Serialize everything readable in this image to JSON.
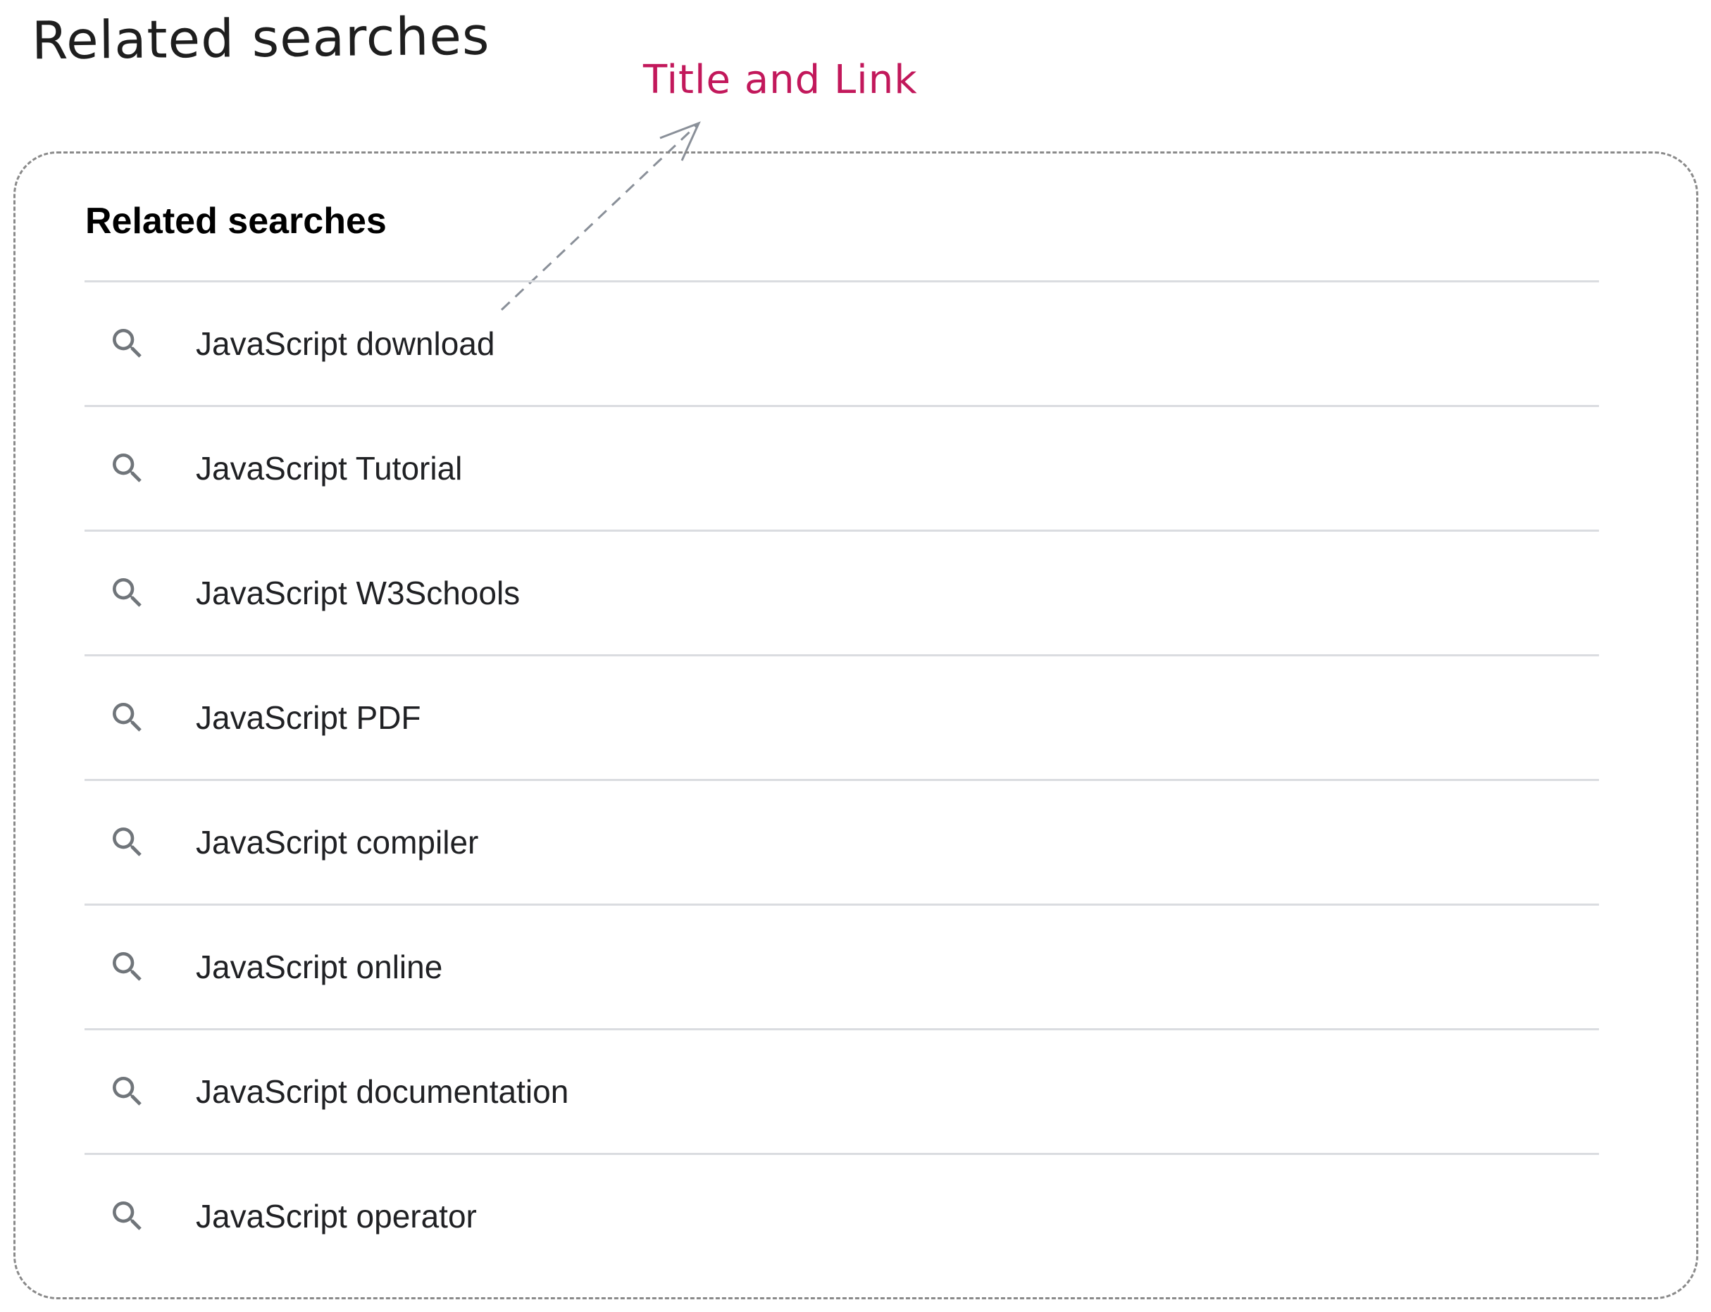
{
  "annotation": {
    "title": "Related searches",
    "callout": "Title and Link",
    "callout_color": "#c2185b"
  },
  "panel": {
    "heading": "Related searches",
    "items": [
      {
        "label": "JavaScript download",
        "icon": "search-icon"
      },
      {
        "label": "JavaScript Tutorial",
        "icon": "search-icon"
      },
      {
        "label": "JavaScript W3Schools",
        "icon": "search-icon"
      },
      {
        "label": "JavaScript PDF",
        "icon": "search-icon"
      },
      {
        "label": "JavaScript compiler",
        "icon": "search-icon"
      },
      {
        "label": "JavaScript online",
        "icon": "search-icon"
      },
      {
        "label": "JavaScript documentation",
        "icon": "search-icon"
      },
      {
        "label": "JavaScript operator",
        "icon": "search-icon"
      }
    ]
  }
}
